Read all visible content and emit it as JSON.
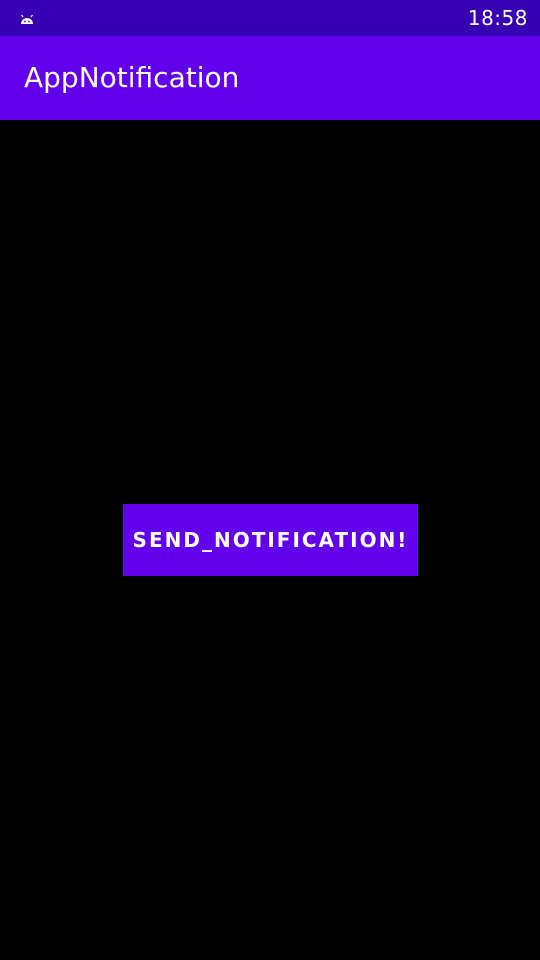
{
  "status_bar": {
    "time": "18:58",
    "notification_icon": "android-icon"
  },
  "app_bar": {
    "title": "AppNotification"
  },
  "main": {
    "send_button_label": "SEND_NOTIFICATION!"
  },
  "colors": {
    "status_bar_bg": "#3700B3",
    "app_bar_bg": "#6200EE",
    "button_bg": "#6200EE",
    "content_bg": "#000000",
    "text_on_primary": "#FFFFFF"
  }
}
